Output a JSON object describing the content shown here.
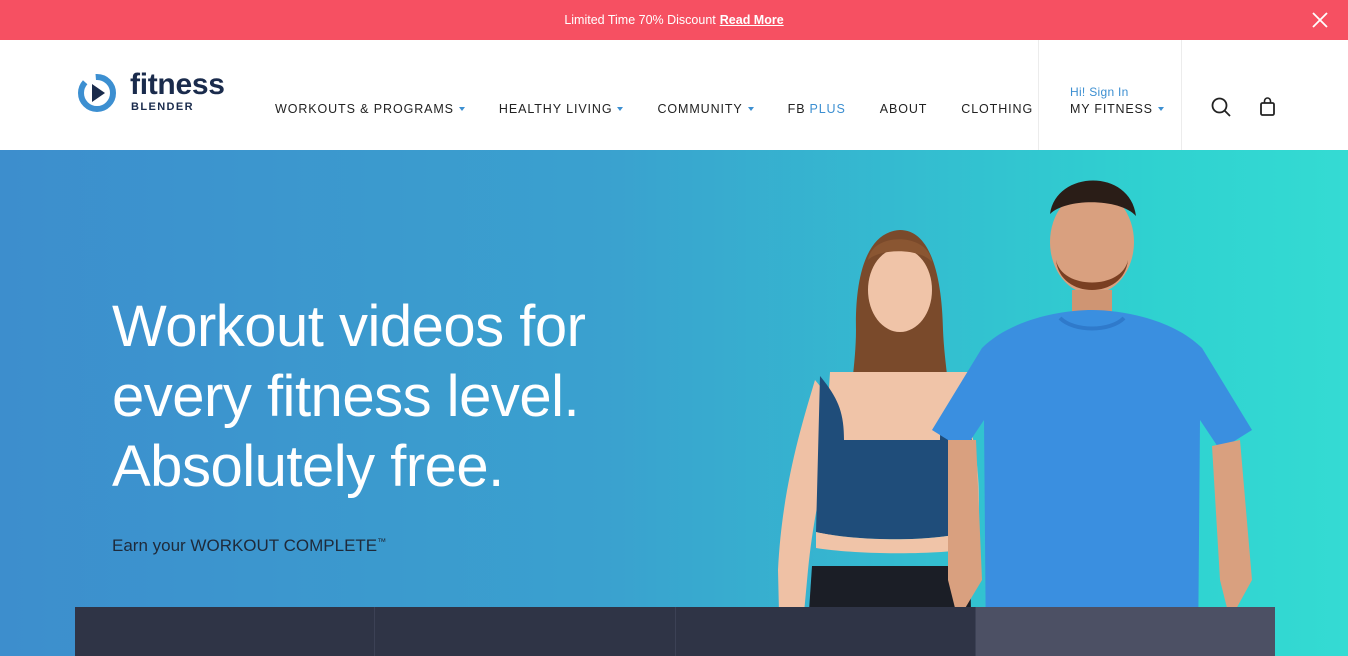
{
  "promo": {
    "text": "Limited Time 70% Discount",
    "link_label": "Read More"
  },
  "brand": {
    "name_top": "fitness",
    "name_bottom": "BLENDER",
    "color": "#1a2b4c",
    "accent": "#3c8fd1"
  },
  "nav": {
    "workouts": "WORKOUTS & PROGRAMS",
    "healthy": "HEALTHY LIVING",
    "community": "COMMUNITY",
    "fb": "FB",
    "fb_plus": "PLUS",
    "about": "ABOUT",
    "clothing": "CLOTHING"
  },
  "account": {
    "signin": "Hi! Sign In",
    "label": "MY FITNESS"
  },
  "icons": {
    "search": "search-icon",
    "bag": "shopping-bag-icon",
    "close": "close-icon",
    "caret": "chevron-down-icon"
  },
  "hero": {
    "headline_1": "Workout videos for",
    "headline_2": "every fitness level.",
    "headline_3": "Absolutely free.",
    "subtext": "Earn your WORKOUT COMPLETE",
    "trademark": "™",
    "gradient_start": "#3d8ecd",
    "gradient_end": "#34dbd3"
  },
  "promo_color": "#f65062"
}
